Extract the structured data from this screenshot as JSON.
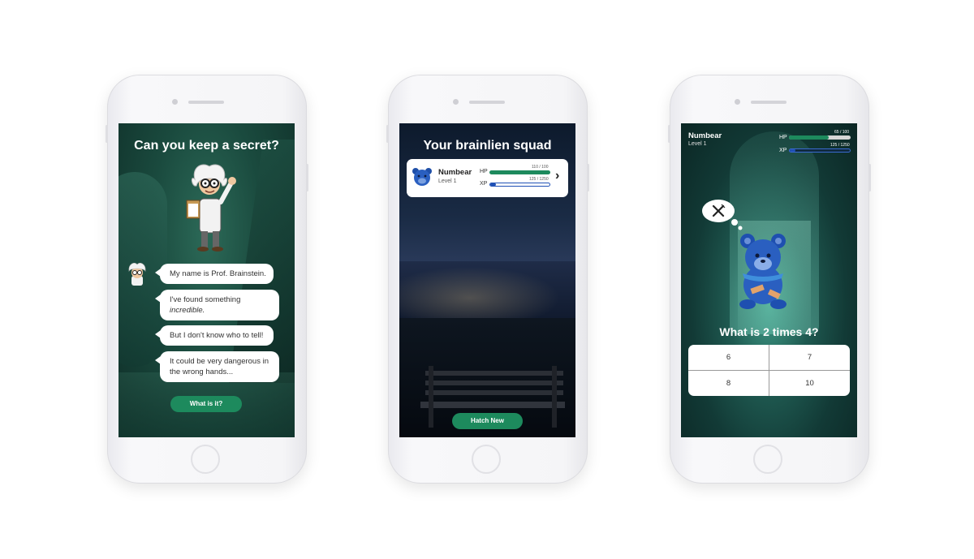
{
  "screen1": {
    "title": "Can you keep a secret?",
    "messages": [
      "My name is Prof. Brainstein.",
      "I've found something",
      "incredible.",
      "But I don't know who to tell!",
      "It could be very dangerous in",
      "the wrong hands..."
    ],
    "button": "What is it?"
  },
  "screen2": {
    "title": "Your brainlien squad",
    "card": {
      "name": "Numbear",
      "level": "Level 1",
      "hp_label": "HP",
      "hp_text": "110 / 100",
      "hp_fraction": 1.0,
      "xp_label": "XP",
      "xp_text": "125 / 1250",
      "xp_fraction": 0.1,
      "chevron": "›"
    },
    "button": "Hatch New"
  },
  "screen3": {
    "name": "Numbear",
    "level": "Level 1",
    "hp_label": "HP",
    "hp_text": "65 / 100",
    "hp_fraction": 0.65,
    "xp_label": "XP",
    "xp_text": "125 / 1250",
    "xp_fraction": 0.1,
    "thought_icon": "fork-knife-icon",
    "question": "What is 2 times 4?",
    "answers": [
      "6",
      "7",
      "8",
      "10"
    ]
  },
  "colors": {
    "accent_green": "#1d8a5d",
    "hp_green": "#1d8a5d",
    "xp_blue": "#1f50b5"
  }
}
